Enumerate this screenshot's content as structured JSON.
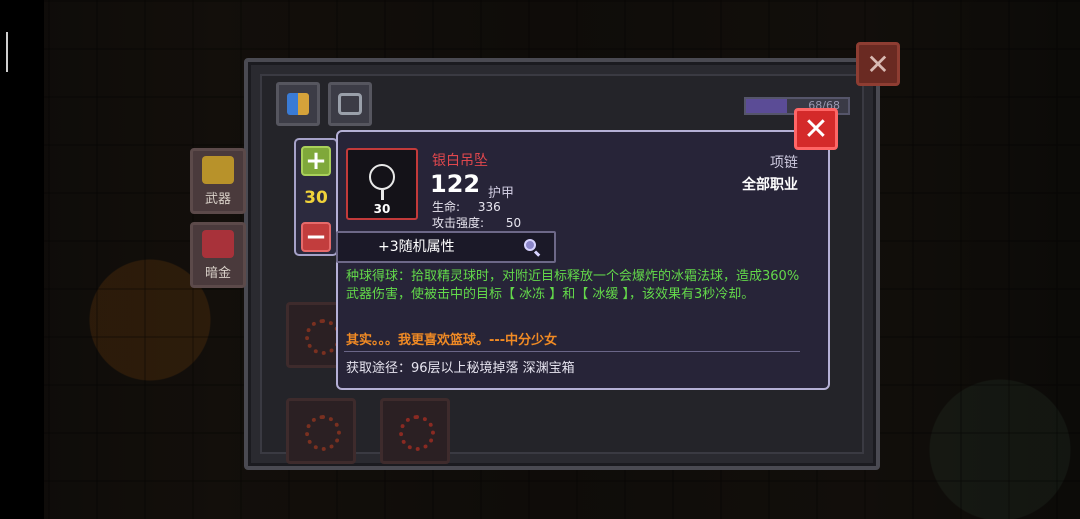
{
  "inventory": {
    "capacity_text": "68/68",
    "tabs": [
      {
        "label": "武器"
      },
      {
        "label": "暗金"
      }
    ],
    "close_symbol": "✕"
  },
  "stepper": {
    "plus_symbol": "+",
    "minus_symbol": "−",
    "value": "30"
  },
  "item": {
    "name": "银白吊坠",
    "icon": "pendant-icon",
    "count": "30",
    "main_value": "122",
    "main_label": "护甲",
    "attributes": [
      {
        "label": "生命:",
        "value": "336"
      },
      {
        "label": "攻击强度:",
        "value": "50"
      }
    ],
    "type": "项链",
    "class_restriction": "全部职业",
    "random_attributes": "+3随机属性",
    "description": "种球得球：拾取精灵球时，对附近目标释放一个会爆炸的冰霜法球，造成360%武器伤害，使被击中的目标【 冰冻 】和【 冰缓 】，该效果有3秒冷却。",
    "flavor": "其实。。。我更喜欢篮球。---中分少女",
    "source": "获取途径：96层以上秘境掉落 深渊宝箱"
  },
  "tooltip": {
    "close_symbol": "✕"
  },
  "colors": {
    "rarity_red": "#e0474d",
    "effect_green": "#63d94a",
    "flavor_orange": "#f08a24",
    "stepper_value": "#f0d23a"
  }
}
